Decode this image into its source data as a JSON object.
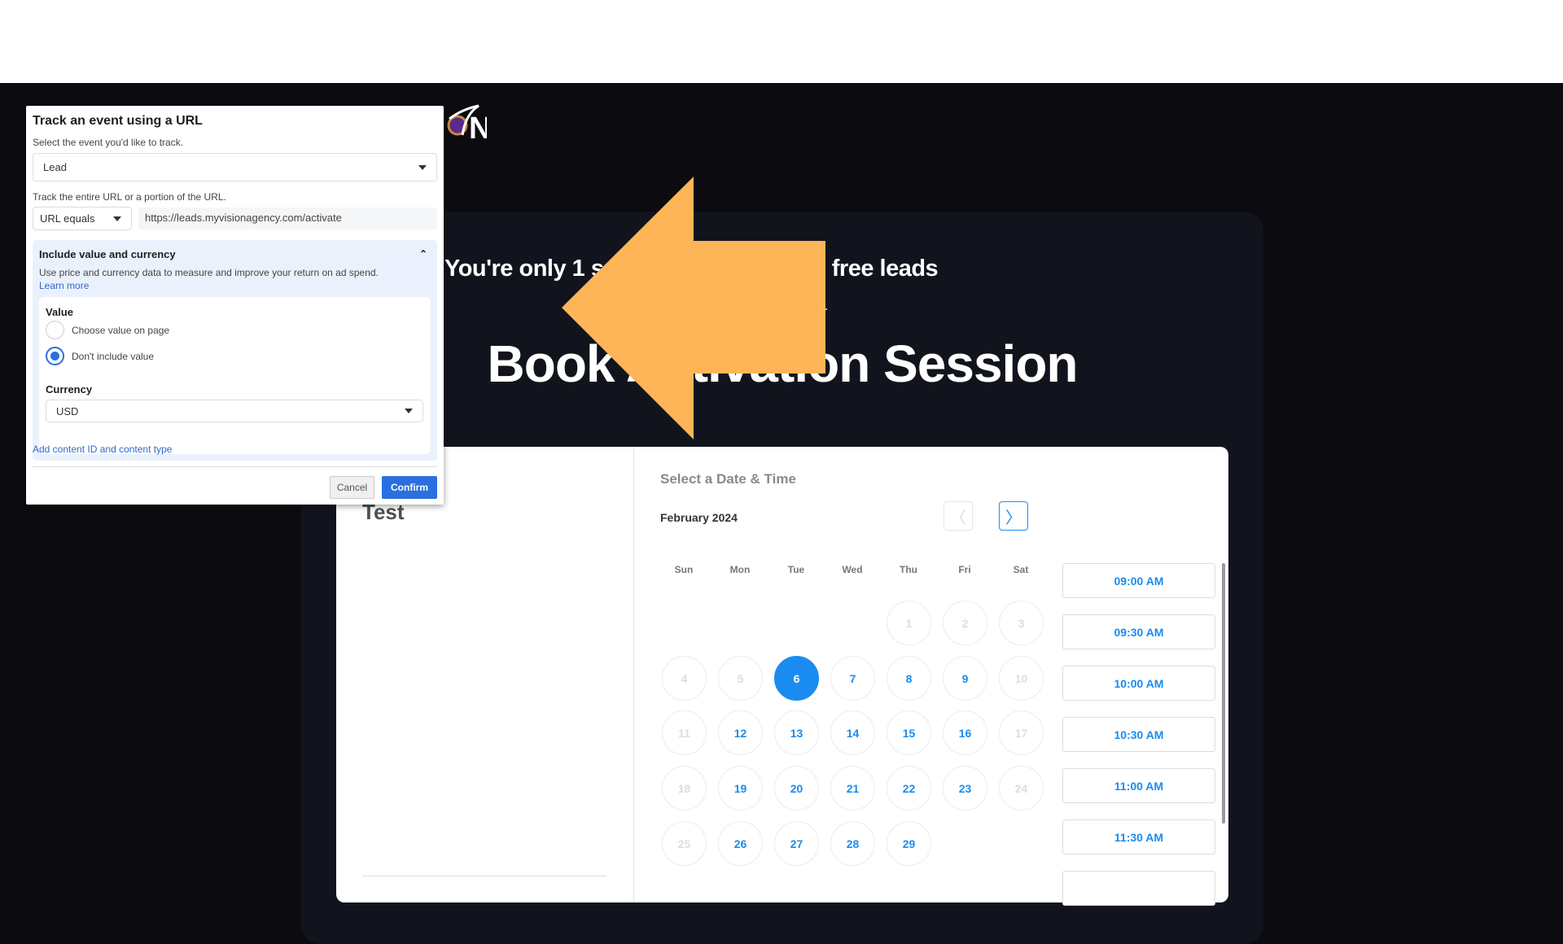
{
  "colors": {
    "accent": "#1a8cf0",
    "arrow": "#FDB557",
    "fb_blue": "#2a6fe0"
  },
  "hero": {
    "headline": "You're only 1 s          ivating your 20 free leads",
    "title": "Book Activation Session",
    "logo_letter": "N"
  },
  "booking": {
    "event_name": "Test",
    "section_title": "Select a Date & Time",
    "month": "February 2024",
    "prev_icon": "chevron-left-icon",
    "next_icon": "chevron-right-icon",
    "weekdays": [
      "Sun",
      "Mon",
      "Tue",
      "Wed",
      "Thu",
      "Fri",
      "Sat"
    ],
    "first_weekday": 4,
    "days_in_month": 29,
    "selected_day": 6,
    "available_days": [
      6,
      7,
      8,
      9,
      12,
      13,
      14,
      15,
      16,
      19,
      20,
      21,
      22,
      23,
      26,
      27,
      28,
      29
    ],
    "times": [
      "09:00 AM",
      "09:30 AM",
      "10:00 AM",
      "10:30 AM",
      "11:00 AM",
      "11:30 AM",
      ""
    ]
  },
  "dialog": {
    "title": "Track an event using a URL",
    "event_label": "Select the event you'd like to track.",
    "event_value": "Lead",
    "url_label": "Track the entire URL or a portion of the URL.",
    "url_match": "URL equals",
    "url_value": "https://leads.myvisionagency.com/activate",
    "section_title": "Include value and currency",
    "section_desc": "Use price and currency data to measure and improve your return on ad spend.",
    "learn_more": "Learn more",
    "value_label": "Value",
    "options": [
      {
        "label": "Choose value on page",
        "selected": false
      },
      {
        "label": "Don't include value",
        "selected": true
      }
    ],
    "currency_label": "Currency",
    "currency_value": "USD",
    "add_content": "Add content ID and content type",
    "cancel": "Cancel",
    "confirm": "Confirm"
  }
}
